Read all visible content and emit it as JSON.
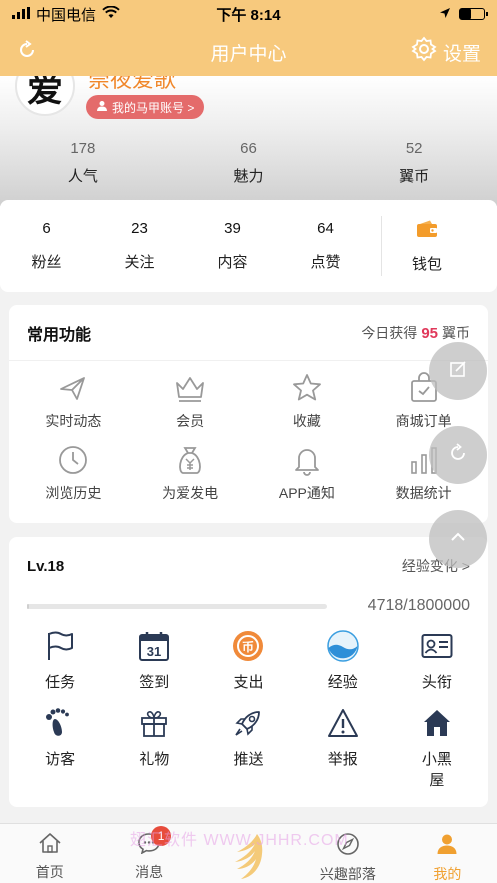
{
  "status_bar": {
    "carrier": "中国电信",
    "time": "下午 8:14"
  },
  "header": {
    "title": "用户中心",
    "settings_label": "设置"
  },
  "profile": {
    "avatar_char": "爱",
    "username": "崇夜爱歌",
    "alt_account_label": "我的马甲账号 >",
    "stats": [
      {
        "value": "178",
        "label": "人气"
      },
      {
        "value": "66",
        "label": "魅力"
      },
      {
        "value": "52",
        "label": "翼币"
      }
    ]
  },
  "social": {
    "items": [
      {
        "value": "6",
        "label": "粉丝"
      },
      {
        "value": "23",
        "label": "关注"
      },
      {
        "value": "39",
        "label": "内容"
      },
      {
        "value": "64",
        "label": "点赞"
      }
    ],
    "wallet_label": "钱包"
  },
  "common_functions": {
    "title": "常用功能",
    "today_prefix": "今日获得",
    "today_value": "95",
    "today_unit": "翼币",
    "items": [
      {
        "label": "实时动态",
        "icon": "plane-icon"
      },
      {
        "label": "会员",
        "icon": "crown-icon"
      },
      {
        "label": "收藏",
        "icon": "star-icon"
      },
      {
        "label": "商城订单",
        "icon": "bag-check-icon"
      },
      {
        "label": "浏览历史",
        "icon": "clock-icon"
      },
      {
        "label": "为爱发电",
        "icon": "money-bag-icon"
      },
      {
        "label": "APP通知",
        "icon": "bell-icon"
      },
      {
        "label": "数据统计",
        "icon": "bar-chart-icon"
      }
    ]
  },
  "level": {
    "title": "Lv.18",
    "link_label": "经验变化 >",
    "progress_text": "4718/1800000",
    "progress_fraction": 0.0026,
    "items": [
      {
        "label": "任务",
        "icon": "flag-icon"
      },
      {
        "label": "签到",
        "icon": "calendar-icon"
      },
      {
        "label": "支出",
        "icon": "coin-icon"
      },
      {
        "label": "经验",
        "icon": "wave-icon"
      },
      {
        "label": "头衔",
        "icon": "id-card-icon"
      },
      {
        "label": "访客",
        "icon": "footprint-icon"
      },
      {
        "label": "礼物",
        "icon": "gift-icon"
      },
      {
        "label": "推送",
        "icon": "rocket-icon"
      },
      {
        "label": "举报",
        "icon": "warning-icon"
      },
      {
        "label": "小黑屋",
        "icon": "house-icon"
      }
    ]
  },
  "calendar_day": "31",
  "coin_char": "币",
  "tab_bar": {
    "tabs": [
      {
        "label": "首页",
        "icon": "home-icon"
      },
      {
        "label": "消息",
        "icon": "message-icon",
        "badge": "1"
      },
      {
        "label": "",
        "icon": "wing-logo-icon"
      },
      {
        "label": "兴趣部落",
        "icon": "compass-icon"
      },
      {
        "label": "我的",
        "icon": "person-icon"
      }
    ]
  },
  "watermark": "翅汇软件 WWW.JHHR.COM",
  "colors": {
    "header": "#f7c97d",
    "accent": "#f0a030",
    "highlight": "#e0385a",
    "alt_badge": "#e46b6b"
  }
}
